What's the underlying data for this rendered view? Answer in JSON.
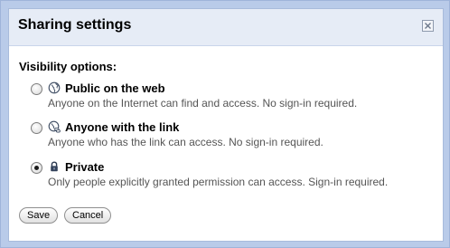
{
  "dialog": {
    "title": "Sharing settings",
    "close_icon": "close-icon"
  },
  "visibility": {
    "section_label": "Visibility options:",
    "options": [
      {
        "label": "Public on the web",
        "description": "Anyone on the Internet can find and access. No sign-in required.",
        "icon": "globe-icon",
        "selected": false
      },
      {
        "label": "Anyone with the link",
        "description": "Anyone who has the link can access. No sign-in required.",
        "icon": "link-globe-icon",
        "selected": false
      },
      {
        "label": "Private",
        "description": "Only people explicitly granted permission can access. Sign-in required.",
        "icon": "lock-icon",
        "selected": true
      }
    ]
  },
  "buttons": {
    "save_label": "Save",
    "cancel_label": "Cancel"
  },
  "colors": {
    "frame": "#b9cbe9",
    "title_bar": "#e6ecf6",
    "description_text": "#555555"
  }
}
